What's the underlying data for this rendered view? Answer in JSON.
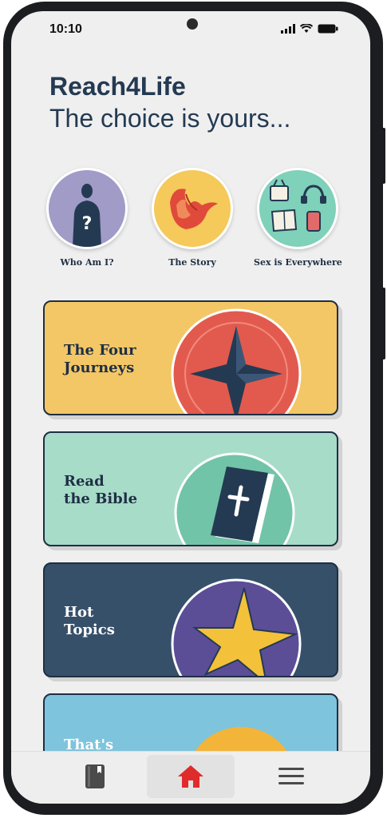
{
  "status_bar": {
    "time": "10:10"
  },
  "header": {
    "title": "Reach4Life",
    "subtitle": "The choice is yours..."
  },
  "featured": [
    {
      "label": "Who Am I?",
      "icon": "person-question-icon",
      "color": "#a09bc7"
    },
    {
      "label": "The Story",
      "icon": "dove-icon",
      "color": "#f5c95a"
    },
    {
      "label": "Sex is Everywhere",
      "icon": "media-collage-icon",
      "color": "#7fd1b9"
    }
  ],
  "cards": [
    {
      "label": "The Four\nJourneys",
      "icon": "compass-star-icon",
      "bg": "#f3c766",
      "text_color": "#1e2f44"
    },
    {
      "label": "Read\nthe Bible",
      "icon": "bible-icon",
      "bg": "#a7dcc8",
      "text_color": "#1e2f44"
    },
    {
      "label": "Hot\nTopics",
      "icon": "star-icon",
      "bg": "#37506a",
      "text_color": "#ffffff"
    },
    {
      "label": "That's",
      "icon": "sun-icon",
      "bg": "#7ec4dc",
      "text_color": "#ffffff"
    }
  ],
  "bottom_nav": [
    {
      "name": "library",
      "icon": "book-icon"
    },
    {
      "name": "home",
      "icon": "home-icon",
      "active": true,
      "color": "#e02b2b"
    },
    {
      "name": "menu",
      "icon": "menu-icon"
    }
  ]
}
